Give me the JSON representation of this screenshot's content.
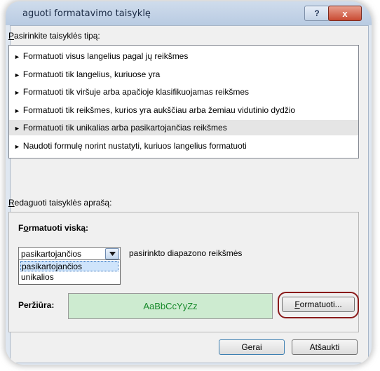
{
  "window": {
    "title": "aguoti formatavimo taisyklę",
    "help_label": "?",
    "close_label": "x"
  },
  "rule_type": {
    "label": "Pasirinkite taisyklės tipą:",
    "items": [
      {
        "label": "Formatuoti visus langelius pagal jų reikšmes",
        "selected": false
      },
      {
        "label": "Formatuoti tik langelius, kuriuose yra",
        "selected": false
      },
      {
        "label": "Formatuoti tik viršuje arba apačioje klasifikuojamas reikšmes",
        "selected": false
      },
      {
        "label": "Formatuoti tik reikšmes, kurios yra aukščiau arba žemiau vidutinio dydžio",
        "selected": false
      },
      {
        "label": "Formatuoti tik unikalias arba pasikartojančias reikšmes",
        "selected": true
      },
      {
        "label": "Naudoti formulę norint nustatyti, kuriuos langelius formatuoti",
        "selected": false
      }
    ],
    "bullet": "►"
  },
  "description": {
    "label": "Redaguoti taisyklės aprašą:",
    "format_all_label": "Formatuoti viską:",
    "combo_value": "pasikartojančios",
    "combo_suffix": "pasirinkto diapazono reikšmės",
    "options": [
      "pasikartojančios",
      "unikalios"
    ],
    "preview_label": "Peržiūra:",
    "preview_text": "AaBbCcYyZz",
    "format_button": "Formatuoti..."
  },
  "footer": {
    "ok": "Gerai",
    "cancel": "Atšaukti"
  }
}
